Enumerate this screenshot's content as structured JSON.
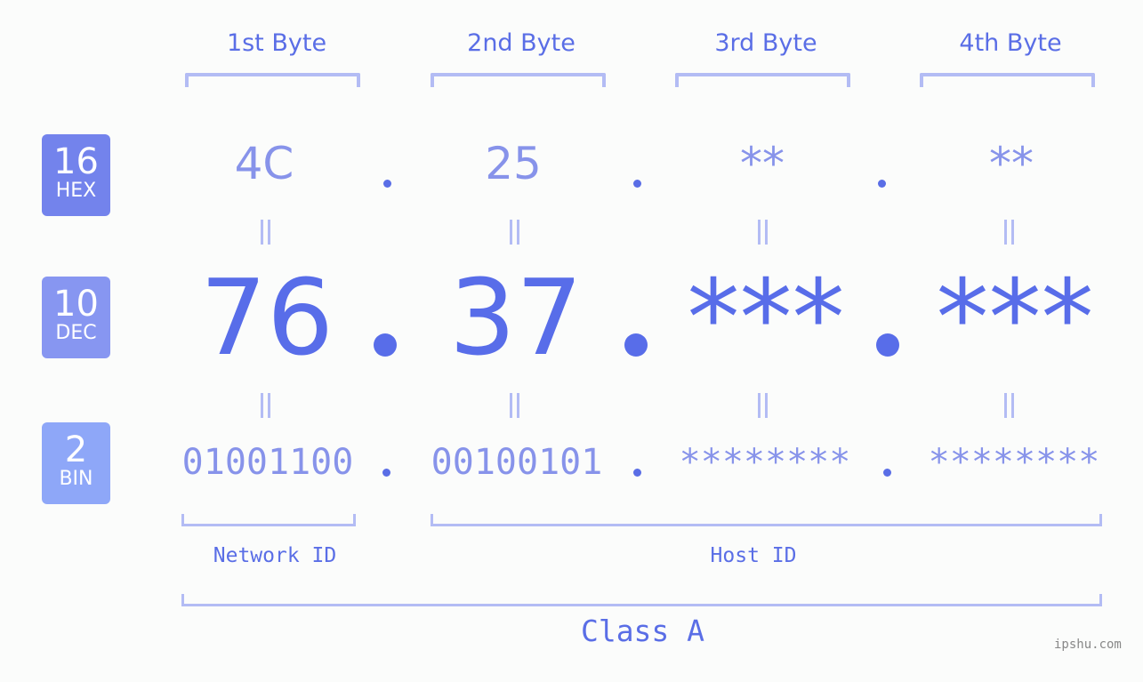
{
  "byte_headers": [
    "1st Byte",
    "2nd Byte",
    "3rd Byte",
    "4th Byte"
  ],
  "badges": [
    {
      "base": "16",
      "label": "HEX",
      "color": "#7383ec"
    },
    {
      "base": "10",
      "label": "DEC",
      "color": "#8796f1"
    },
    {
      "base": "2",
      "label": "BIN",
      "color": "#8ea7f8"
    }
  ],
  "hex_values": [
    "4C",
    "25",
    "**",
    "**"
  ],
  "dec_values": [
    "76",
    "37",
    "***",
    "***"
  ],
  "bin_values": [
    "01001100",
    "00100101",
    "********",
    "********"
  ],
  "network_id_label": "Network ID",
  "host_id_label": "Host ID",
  "class_label": "Class A",
  "watermark": "ipshu.com",
  "colors": {
    "accent": "#586de9",
    "light": "#8793ea",
    "bracket": "#b3bcf4"
  }
}
